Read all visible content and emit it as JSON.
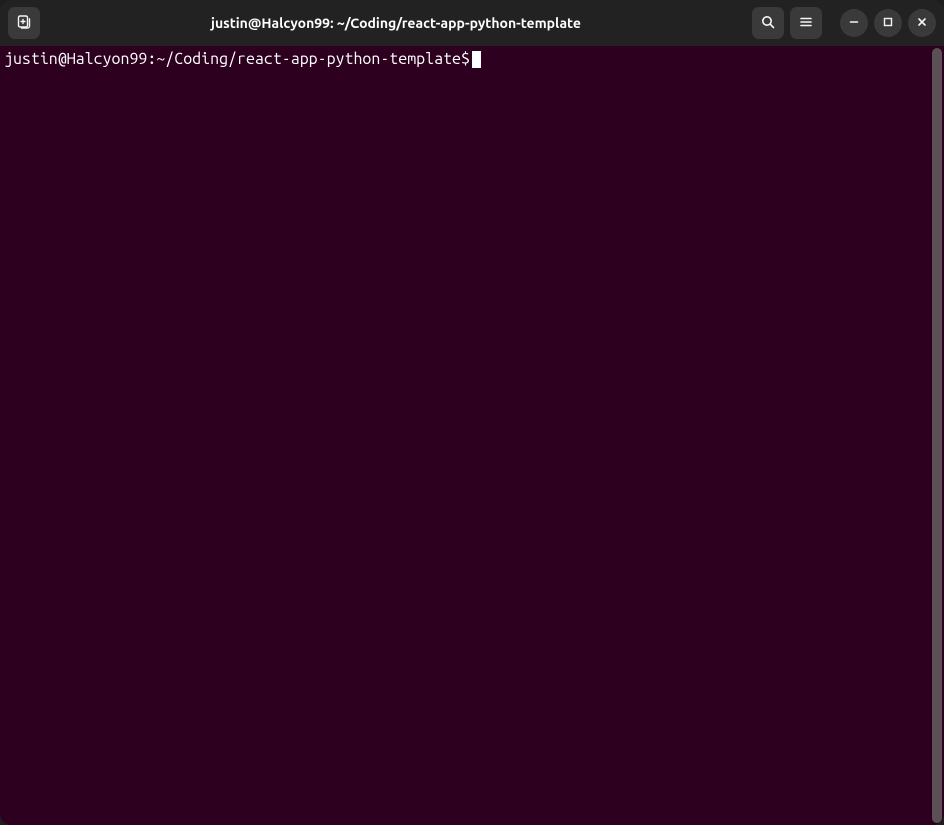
{
  "window": {
    "title": "justin@Halcyon99: ~/Coding/react-app-python-template"
  },
  "terminal": {
    "prompt": {
      "user_host": "justin@Halcyon99",
      "separator": ":",
      "path": "~/Coding/react-app-python-template",
      "symbol": "$"
    }
  }
}
